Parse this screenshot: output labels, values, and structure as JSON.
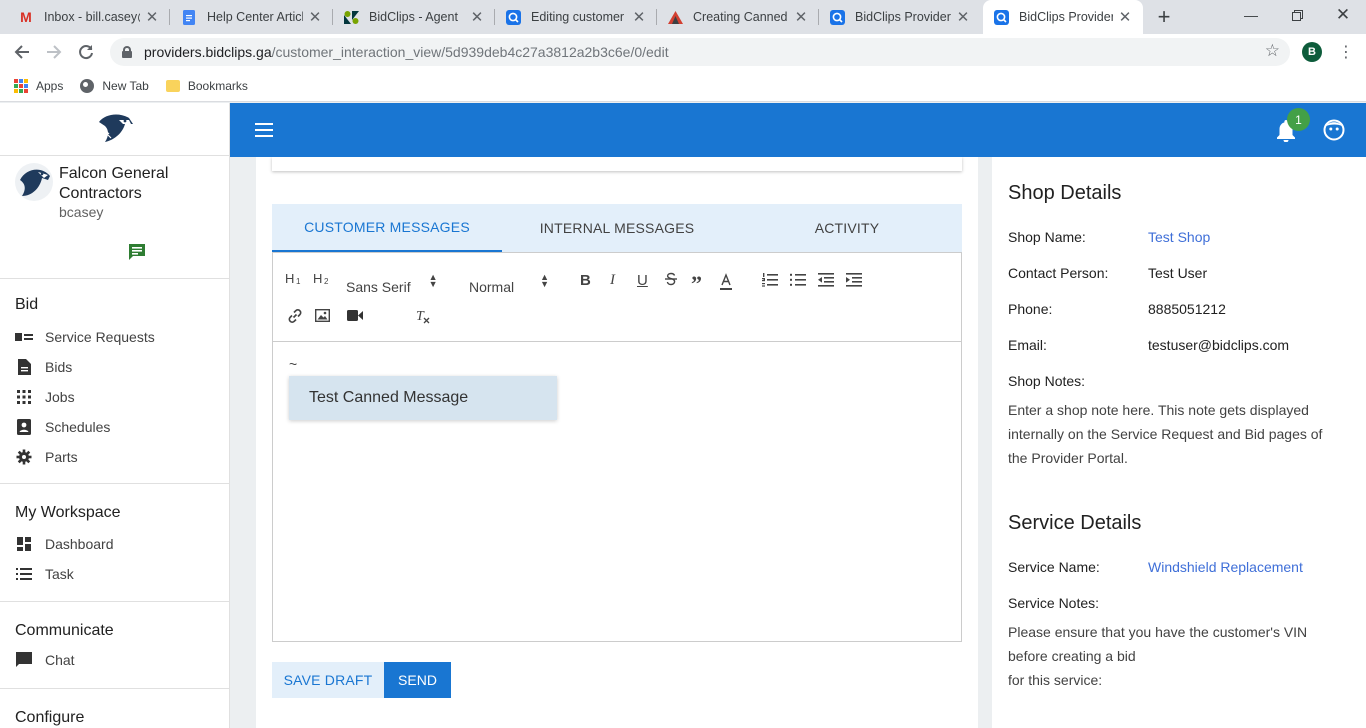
{
  "browser": {
    "tabs": [
      {
        "title": "Inbox - bill.casey@",
        "icon": "gmail-icon"
      },
      {
        "title": "Help Center Articl",
        "icon": "docs-icon"
      },
      {
        "title": "BidClips - Agent",
        "icon": "zendesk-icon"
      },
      {
        "title": "Editing customer c",
        "icon": "bidclips-icon"
      },
      {
        "title": "Creating Canned M",
        "icon": "creating-icon"
      },
      {
        "title": "BidClips Provider P",
        "icon": "bidclips-icon"
      },
      {
        "title": "BidClips Provider P",
        "icon": "bidclips-icon"
      }
    ],
    "url_host": "providers.bidclips.ga",
    "url_path": "/customer_interaction_view/5d939deb4c27a3812a2b3c6e/0/edit",
    "profile_initial": "B",
    "bookmarks": [
      "Apps",
      "New Tab",
      "Bookmarks"
    ]
  },
  "sidebar": {
    "company": "Falcon General Contractors",
    "username": "bcasey",
    "sections": {
      "bid": {
        "title": "Bid",
        "items": [
          "Service Requests",
          "Bids",
          "Jobs",
          "Schedules",
          "Parts"
        ]
      },
      "workspace": {
        "title": "My Workspace",
        "items": [
          "Dashboard",
          "Task"
        ]
      },
      "communicate": {
        "title": "Communicate",
        "items": [
          "Chat"
        ]
      },
      "configure": {
        "title": "Configure"
      }
    }
  },
  "topbar": {
    "notification_count": "1"
  },
  "messages": {
    "tabs": [
      "CUSTOMER MESSAGES",
      "INTERNAL MESSAGES",
      "ACTIVITY"
    ],
    "active_tab": 0,
    "toolbar": {
      "font": "Sans Serif",
      "size": "Normal"
    },
    "editor_text": "~",
    "suggestion": "Test Canned Message",
    "save_draft": "SAVE DRAFT",
    "send": "SEND"
  },
  "shop": {
    "title": "Shop Details",
    "name_label": "Shop Name:",
    "name": "Test Shop",
    "contact_label": "Contact Person:",
    "contact": "Test User",
    "phone_label": "Phone:",
    "phone": "8885051212",
    "email_label": "Email:",
    "email": "testuser@bidclips.com",
    "notes_label": "Shop Notes:",
    "notes": "Enter a shop note here.  This note gets displayed internally on the Service Request and Bid pages of the Provider Portal."
  },
  "service": {
    "title": "Service Details",
    "name_label": "Service Name:",
    "name": "Windshield Replacement",
    "notes_label": "Service Notes:",
    "notes_line1": "Please ensure that you have the customer's VIN before creating a bid",
    "notes_line2": "for this service:"
  },
  "colors": {
    "primary": "#1976d2",
    "tab_bg": "#e3effa",
    "badge": "#43a047",
    "link": "#3f6fd8"
  }
}
